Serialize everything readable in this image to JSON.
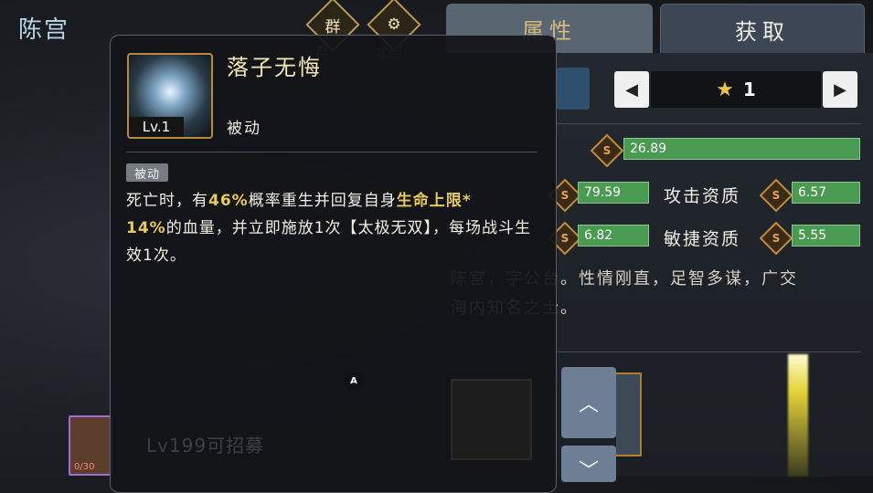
{
  "hero": {
    "name": "陈宫"
  },
  "header": {
    "faction_icon": "群",
    "faction_label": "群",
    "second_icon": "gear-icon",
    "second_label": "北固"
  },
  "tabs": [
    {
      "label": "属性",
      "active": true
    },
    {
      "label": "获取",
      "active": false
    }
  ],
  "star_selector": {
    "prev_icon": "◀",
    "next_icon": "▶",
    "star_icon": "★",
    "value": "1"
  },
  "stats": {
    "total_value": "26.89",
    "hp_value": "79.59",
    "attack_label": "攻击资质",
    "attack_value": "6.57",
    "def_value": "6.82",
    "agility_label": "敏捷资质",
    "agility_value": "5.55",
    "bars": {
      "total": 1.0,
      "hp": 0.45,
      "attack": 0.35,
      "def": 0.35,
      "agility": 0.3
    }
  },
  "bio": {
    "line1": "陈宫，字公台。性情刚直，足智多谋，广交",
    "line2": "海内知名之士。"
  },
  "side_buttons": {
    "up": "︿",
    "down": "﹀"
  },
  "avatar_chip": {
    "count": "0/30"
  },
  "faded_text": {
    "recruit": "Lv199可招募"
  },
  "popup": {
    "skill_name": "落子无悔",
    "skill_level": "Lv.1",
    "skill_type": "被动",
    "tag": "被动",
    "desc": {
      "p1": "死亡时，有",
      "h1": "46%",
      "p2": "概率重生并回复自身",
      "h2": "生命上限*",
      "h3": "14%",
      "p3": "的血量，并立即施放1次【太极无双】，每场战斗生效1次。"
    },
    "badge": "A"
  },
  "colors": {
    "accent_gold": "#d6ba7a",
    "bar_green": "#4a9a52",
    "highlight": "#e7c95c"
  }
}
